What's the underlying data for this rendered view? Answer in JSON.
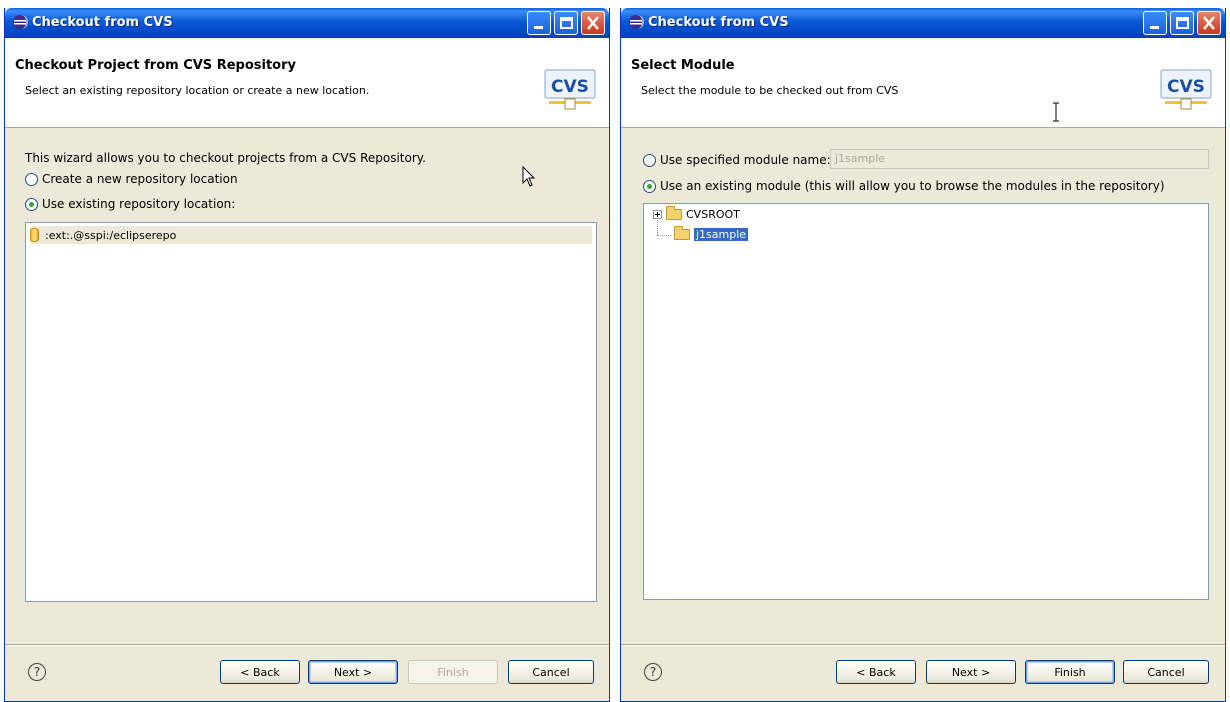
{
  "left": {
    "title": "Checkout from CVS",
    "header_title": "Checkout Project from CVS Repository",
    "header_desc": "Select an existing repository location or create a new location.",
    "intro": "This wizard allows you to checkout projects from a CVS Repository.",
    "radio_new": "Create a new repository location",
    "radio_existing": "Use existing repository location:",
    "repositories": [
      ":ext:.@sspi:/eclipserepo"
    ],
    "buttons": {
      "help": "?",
      "back": "< Back",
      "next": "Next >",
      "finish": "Finish",
      "cancel": "Cancel"
    }
  },
  "right": {
    "title": "Checkout from CVS",
    "header_title": "Select Module",
    "header_desc": "Select the module to be checked out from CVS",
    "radio_specified": "Use specified module name:",
    "module_name_value": "j1sample",
    "radio_existing": "Use an existing module (this will allow you to browse the modules in the repository)",
    "tree": [
      "CVSROOT",
      "j1sample"
    ],
    "buttons": {
      "help": "?",
      "back": "< Back",
      "next": "Next >",
      "finish": "Finish",
      "cancel": "Cancel"
    }
  },
  "logo_text": "CVS",
  "colors": {
    "titlebar": "#0a58d8",
    "selection": "#316ac5",
    "dialog_bg": "#ece9d8",
    "radio_dot": "#3aa335"
  }
}
